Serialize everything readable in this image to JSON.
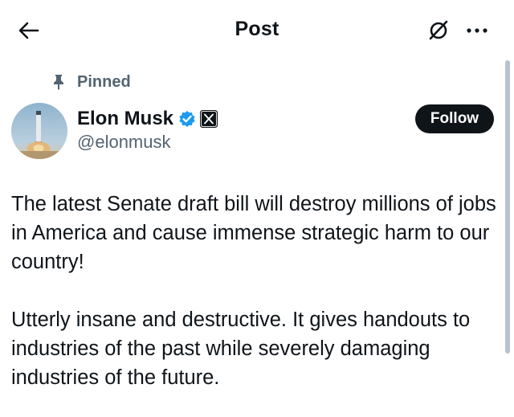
{
  "header": {
    "title": "Post",
    "back_icon": "arrow-left-icon",
    "grok_icon": "grok-icon",
    "more_icon": "more-horizontal-icon"
  },
  "post": {
    "pinned_label": "Pinned",
    "pin_icon": "pin-icon",
    "author": {
      "display_name": "Elon Musk",
      "handle": "@elonmusk",
      "verified_badge": "verified-badge-icon",
      "affiliation_badge": "x-logo-icon"
    },
    "follow_label": "Follow",
    "text": "The latest Senate draft bill will destroy millions of jobs in America and cause immense strategic harm to our country!\n\nUtterly insane and destructive. It gives handouts to industries of the past while severely damaging industries of the future."
  },
  "colors": {
    "text_primary": "#0f1419",
    "text_secondary": "#536471",
    "verified_blue": "#1d9bf0",
    "follow_bg": "#0f1419"
  }
}
